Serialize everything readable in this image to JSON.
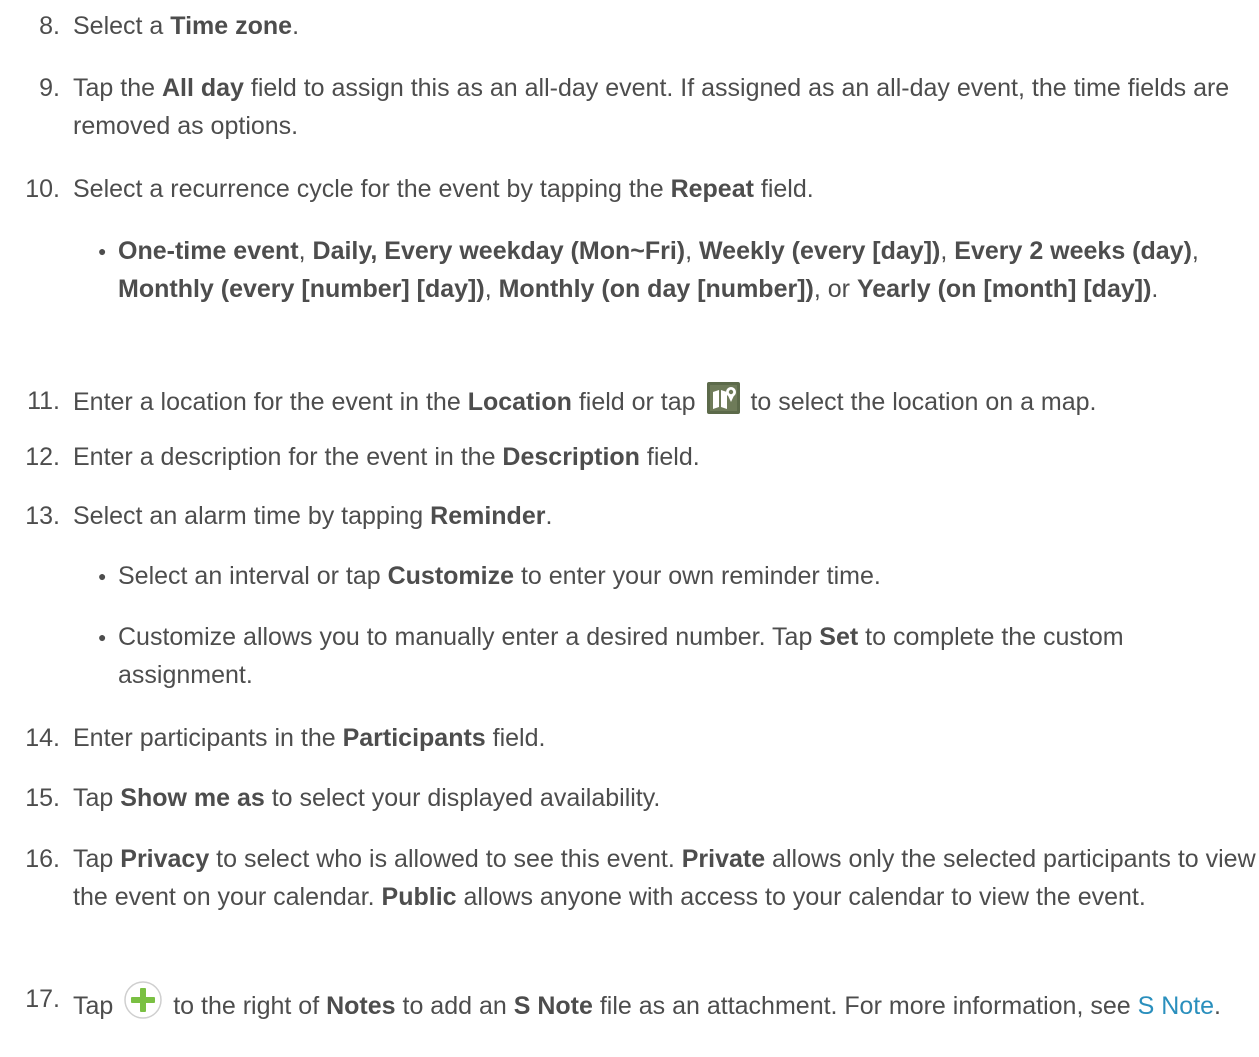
{
  "steps": [
    {
      "num": "8.",
      "parts": [
        "Select a ",
        "Time zone",
        "."
      ]
    },
    {
      "num": "9.",
      "parts": [
        "Tap the ",
        "All day",
        " field to assign this as an all-day event. If assigned as an all-day event, the time fields are removed as options."
      ]
    },
    {
      "num": "10.",
      "parts": [
        "Select a recurrence cycle for the event by tapping the ",
        "Repeat",
        " field."
      ]
    },
    {
      "num": "11.",
      "parts": [
        "Enter a location for the event in the ",
        "Location",
        " field or tap ",
        " to select the location on a map."
      ]
    },
    {
      "num": "12.",
      "parts": [
        "Enter a description for the event in the ",
        "Description",
        " field."
      ]
    },
    {
      "num": "13.",
      "parts": [
        "Select an alarm time by tapping ",
        "Reminder",
        "."
      ]
    },
    {
      "num": "14.",
      "parts": [
        "Enter participants in the ",
        "Participants",
        " field."
      ]
    },
    {
      "num": "15.",
      "parts": [
        "Tap ",
        "Show me as",
        " to select your displayed availability."
      ]
    },
    {
      "num": "16.",
      "parts": [
        "Tap ",
        "Privacy",
        " to select who is allowed to see this event. ",
        "Private",
        " allows only the selected participants to view the event on your calendar. ",
        "Public",
        " allows anyone with access to your calendar to view the event."
      ]
    },
    {
      "num": "17.",
      "parts": [
        "Tap ",
        " to the right of ",
        "Notes",
        " to add an ",
        "S Note",
        " file as an attachment. For more information, see ",
        "S Note",
        "."
      ]
    }
  ],
  "repeat_options": [
    "One-time event",
    ", ",
    "Daily, Every weekday (Mon~Fri)",
    ", ",
    "Weekly (every [day])",
    ", ",
    "Every 2 weeks (day)",
    ", ",
    "Monthly (every [number] [day])",
    ", ",
    "Monthly (on day [number])",
    ", or ",
    "Yearly (on [month] [day])",
    "."
  ],
  "reminder_bullets": [
    [
      "Select an interval or tap ",
      "Customize",
      " to enter your own reminder time."
    ],
    [
      "Customize allows you to manually enter a desired number. Tap ",
      "Set",
      " to complete the custom assignment."
    ]
  ],
  "bullet_char": "●",
  "icons": {
    "map": "map-location-icon",
    "plus": "add-note-icon"
  },
  "colors": {
    "text": "#4d4d4d",
    "link": "#2a8fbd",
    "icon_green": "#7ac043"
  }
}
